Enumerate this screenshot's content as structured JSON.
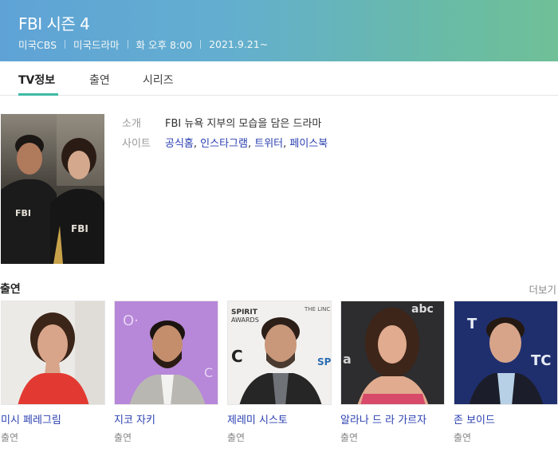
{
  "header": {
    "title": "FBI 시즌 4",
    "meta": [
      "미국CBS",
      "미국드라마",
      "화 오후 8:00",
      "2021.9.21~"
    ]
  },
  "tabs": [
    {
      "label": "TV정보",
      "active": true
    },
    {
      "label": "출연",
      "active": false
    },
    {
      "label": "시리즈",
      "active": false
    }
  ],
  "info": {
    "intro_label": "소개",
    "intro_value": "FBI 뉴욕 지부의 모습을 담은 드라마",
    "site_label": "사이트",
    "sites": [
      "공식홈",
      "인스타그램",
      "트위터",
      "페이스북"
    ],
    "site_separator": ", "
  },
  "cast": {
    "title": "출연",
    "more_label": "더보기",
    "members": [
      {
        "name": "미시 페레그림",
        "role": "출연"
      },
      {
        "name": "지코 자키",
        "role": "출연"
      },
      {
        "name": "제레미 시스토",
        "role": "출연"
      },
      {
        "name": "알라나 드 라 가르자",
        "role": "출연"
      },
      {
        "name": "존 보이드",
        "role": "출연"
      }
    ]
  },
  "colors": {
    "header_gradient_start": "#5fa3d6",
    "header_gradient_end": "#6fc097",
    "tab_accent": "#3dbaa4",
    "link": "#2a3fb0"
  }
}
